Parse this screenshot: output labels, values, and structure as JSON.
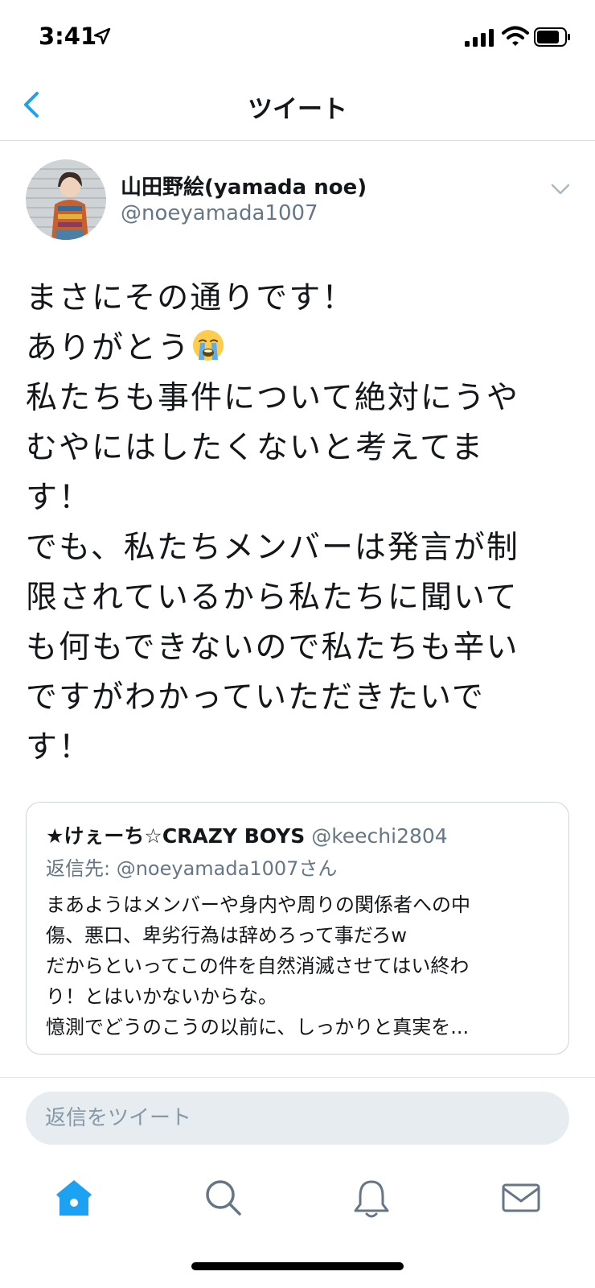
{
  "status_bar": {
    "time": "3:41"
  },
  "nav": {
    "title": "ツイート"
  },
  "tweet": {
    "display_name": "山田野絵(yamada noe)",
    "handle": "@noeyamada1007",
    "lines": [
      "まさにその通りです！",
      "ありがとう",
      "私たちも事件について絶対にうや",
      "むやにはしたくないと考えてま",
      "す！",
      "でも、私たちメンバーは発言が制",
      "限されているから私たちに聞いて",
      "も何もできないので私たちも辛い",
      "ですがわかっていただきたいで",
      "す！"
    ],
    "emoji": "loudly-crying-face-icon"
  },
  "quote": {
    "name": "★けぇーち☆CRAZY BOYS",
    "handle": "@keechi2804",
    "reply_to": "返信先: @noeyamada1007さん",
    "lines": [
      "まあようはメンバーや身内や周りの関係者への中",
      "傷、悪口、卑劣行為は辞めろって事だろw",
      "だからといってこの件を自然消滅させてはい終わ",
      "り！とはいかないからな。",
      "憶測でどうのこうの以前に、しっかりと真実を..."
    ]
  },
  "reply": {
    "placeholder": "返信をツイート"
  },
  "tab_bar": {
    "tabs": [
      "home-icon",
      "search-icon",
      "bell-icon",
      "mail-icon"
    ]
  },
  "colors": {
    "accent": "#1da1f2",
    "secondary_text": "#657786",
    "icon_gray": "#657786"
  }
}
